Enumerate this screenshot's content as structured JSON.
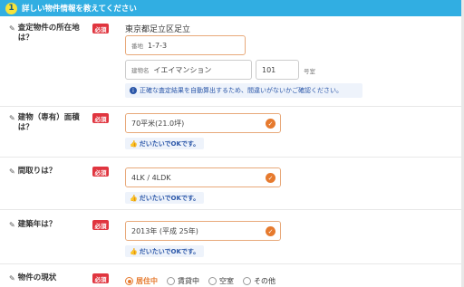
{
  "header": {
    "step": "1",
    "title": "詳しい物件情報を教えてください"
  },
  "required_label": "必須",
  "address": {
    "label": "査定物件の所在地は？",
    "city": "東京都足立区足立",
    "banchi_label": "番地",
    "banchi_value": "1-7-3",
    "building_label": "建物名",
    "building_value": "イエイマンション",
    "room_value": "101",
    "room_label": "号室",
    "note": "正確な査定結果を自動算出するため、間違いがないかご確認ください。"
  },
  "area": {
    "label": "建物（専有）面積は？",
    "value": "70平米(21.0坪)",
    "ok": "だいたいでOKです。"
  },
  "layout": {
    "label": "間取りは？",
    "value": "4LK / 4LDK",
    "ok": "だいたいでOKです。"
  },
  "built": {
    "label": "建築年は？",
    "value": "2013年 (平成 25年)",
    "ok": "だいたいでOKです。"
  },
  "status": {
    "label": "物件の現状",
    "options": [
      "居住中",
      "賃貸中",
      "空室",
      "その他"
    ],
    "selected": "居住中"
  }
}
